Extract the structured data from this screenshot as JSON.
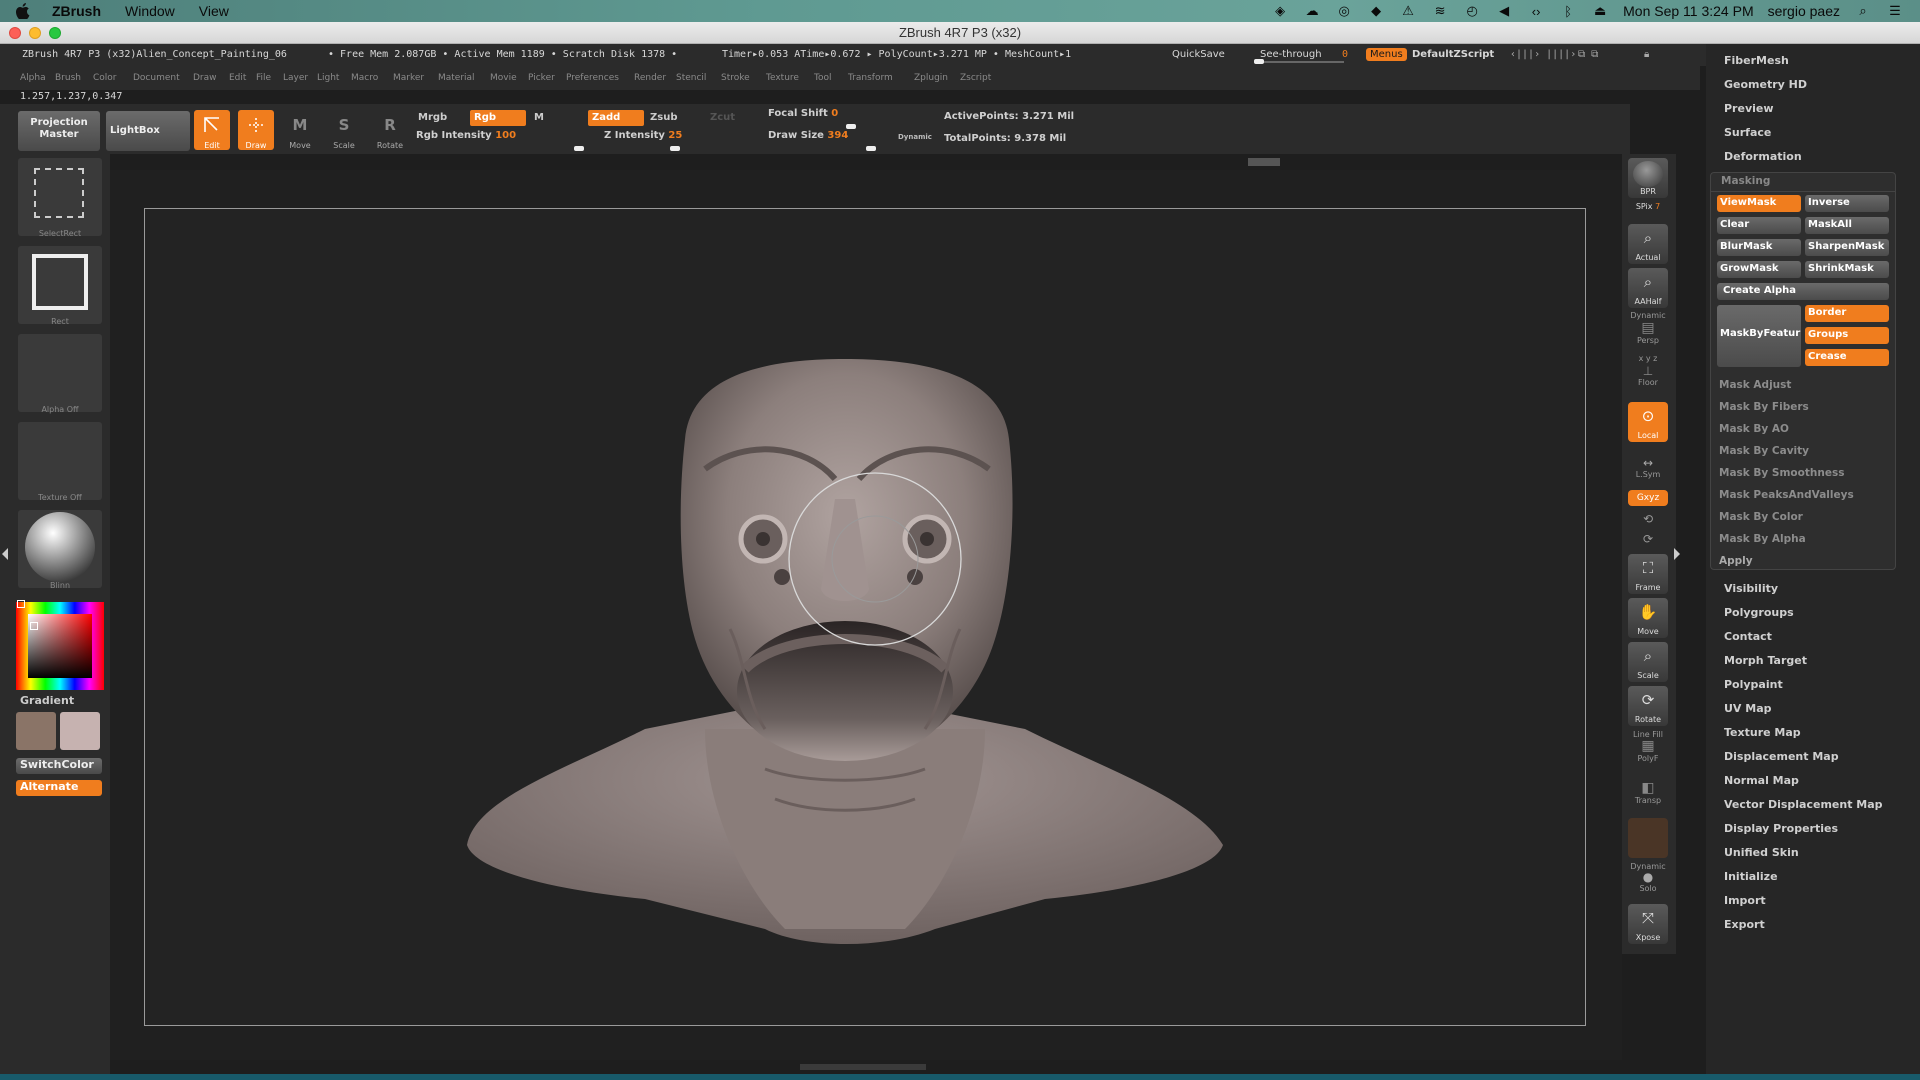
{
  "menubar": {
    "app": "ZBrush",
    "items": [
      "Window",
      "View"
    ],
    "datetime": "Mon Sep 11  3:24 PM",
    "user": "sergio paez"
  },
  "window": {
    "title": "ZBrush 4R7 P3 (x32)"
  },
  "infobar": {
    "doc": "ZBrush 4R7 P3 (x32)Alien_Concept_Painting_06",
    "freemem": "• Free Mem 2.087GB • Active Mem 1189 • Scratch Disk 1378 •",
    "timer": "Timer▸0.053 ATime▸0.672 ▸ PolyCount▸3.271 MP • MeshCount▸1",
    "quicksave": "QuickSave",
    "seethrough": "See-through",
    "seethrough_val": "0",
    "menus": "Menus",
    "zscript": "DefaultZScript"
  },
  "palettes": [
    "Alpha",
    "Brush",
    "Color",
    "Document",
    "Draw",
    "Edit",
    "File",
    "Layer",
    "Light",
    "Macro",
    "Marker",
    "Material",
    "Movie",
    "Picker",
    "Preferences",
    "Render",
    "Stencil",
    "Stroke",
    "Texture",
    "Tool",
    "Transform",
    "Zplugin",
    "Zscript"
  ],
  "coords": "1.257,1.237,0.347",
  "toolbar": {
    "projection_master": "Projection Master",
    "lightbox": "LightBox",
    "edit": "Edit",
    "draw": "Draw",
    "move": "Move",
    "scale": "Scale",
    "rotate": "Rotate",
    "mrgb": "Mrgb",
    "rgb": "Rgb",
    "m": "M",
    "zadd": "Zadd",
    "zsub": "Zsub",
    "zcut": "Zcut",
    "rgb_intensity_label": "Rgb Intensity",
    "rgb_intensity": "100",
    "z_intensity_label": "Z Intensity",
    "z_intensity": "25",
    "focal_shift_label": "Focal Shift",
    "focal_shift": "0",
    "draw_size_label": "Draw Size",
    "draw_size": "394",
    "dynamic": "Dynamic",
    "active_points": "ActivePoints: 3.271  Mil",
    "total_points": "TotalPoints: 9.378  Mil"
  },
  "leftshelf": {
    "select_rect": "SelectRect",
    "rect": "Rect",
    "alpha_off": "Alpha  Off",
    "texture_off": "Texture  Off",
    "material": "Blinn",
    "gradient": "Gradient",
    "switch_color": "SwitchColor",
    "alternate": "Alternate",
    "colors": {
      "main": "#8a7467",
      "secondary": "#c6b2b0"
    }
  },
  "rightshelf": {
    "bpr": "BPR",
    "spix": "SPix",
    "spix_val": "7",
    "actual": "Actual",
    "aahalf": "AAHalf",
    "dynamic": "Dynamic",
    "persp": "Persp",
    "xyz_small": "x y z",
    "floor": "Floor",
    "local": "Local",
    "lsym": "L.Sym",
    "gxyz": "Gxyz",
    "frame": "Frame",
    "move": "Move",
    "scale": "Scale",
    "rotate": "Rotate",
    "linefill": "Line Fill",
    "polyf": "PolyF",
    "transp": "Transp",
    "dynamic2": "Dynamic",
    "solo": "Solo",
    "xpose": "Xpose"
  },
  "rightpanel": {
    "top_items": [
      "FiberMesh",
      "Geometry HD",
      "Preview",
      "Surface",
      "Deformation"
    ],
    "masking": {
      "title": "Masking",
      "buttons": [
        {
          "label": "ViewMask",
          "style": "o"
        },
        {
          "label": "Inverse",
          "style": "g"
        },
        {
          "label": "Clear",
          "style": "g"
        },
        {
          "label": "MaskAll",
          "style": "g"
        },
        {
          "label": "BlurMask",
          "style": "g"
        },
        {
          "label": "SharpenMask",
          "style": "g"
        },
        {
          "label": "GrowMask",
          "style": "g"
        },
        {
          "label": "ShrinkMask",
          "style": "g"
        }
      ],
      "create_alpha": "Create Alpha",
      "mask_by_feature": "MaskByFeatur",
      "feature_opts": [
        "Border",
        "Groups",
        "Crease"
      ],
      "rows": [
        "Mask Adjust",
        "Mask By Fibers",
        "Mask By AO",
        "Mask By Cavity",
        "Mask By Smoothness",
        "Mask PeaksAndValleys",
        "Mask By Color",
        "Mask By Alpha",
        "Apply"
      ]
    },
    "bottom_items": [
      "Visibility",
      "Polygroups",
      "Contact",
      "Morph Target",
      "Polypaint",
      "UV Map",
      "Texture Map",
      "Displacement Map",
      "Normal Map",
      "Vector Displacement Map",
      "Display Properties",
      "Unified Skin",
      "Initialize",
      "Import",
      "Export"
    ]
  }
}
